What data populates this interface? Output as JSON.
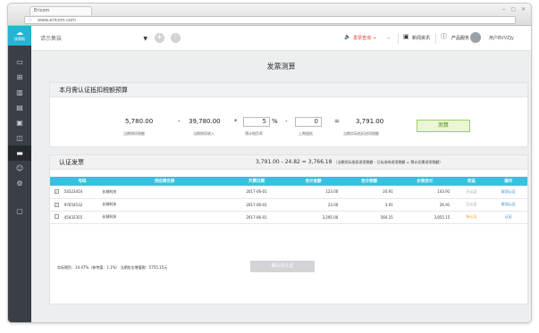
{
  "browser": {
    "tab_title": "Ericom",
    "url": "www.ericom.com",
    "win_controls": "‒ ▢ ✕"
  },
  "sidebar": {
    "logo_text": "核票助",
    "items": [
      {
        "icon": "square-icon"
      },
      {
        "icon": "plus-box-icon"
      },
      {
        "icon": "chart-icon"
      },
      {
        "icon": "document-icon"
      },
      {
        "icon": "clipboard-icon"
      },
      {
        "icon": "invoice-icon"
      },
      {
        "icon": "stamp-icon",
        "active": true
      },
      {
        "icon": "people-icon"
      },
      {
        "icon": "gear-icon"
      },
      {
        "icon": "window-icon"
      }
    ]
  },
  "topbar": {
    "company_placeholder": "请示集装",
    "alert_text": "发票查询 →",
    "news_label": "新闻资讯",
    "help_label": "产品服务",
    "username": "用户BVVZJy"
  },
  "page_title": "发票测算",
  "budget": {
    "heading": "本月需认证抵扣税额预算",
    "values": {
      "a": "5,780.00",
      "op1": "-",
      "b": "39,780.00",
      "op2": "*",
      "rate": "5",
      "rate_unit": "%",
      "op3": "-",
      "prev": "0",
      "op4": "=",
      "result": "3,791.00"
    },
    "captions": {
      "a": "当期销项税额",
      "b": "当期销项收入",
      "rate": "预计税负率",
      "prev": "上期留抵",
      "result": "当期实际抵扣进项税额"
    },
    "measure_button": "测算"
  },
  "invoices": {
    "heading": "认证发票",
    "formula": {
      "text": "3,791.00 - 24.82 = 3,766.18",
      "note": "（当期实际抵扣进项税额 - 已勾选待进项税额 = 预计还需进项税额）"
    },
    "columns": [
      "号码",
      "供应商名称",
      "开票日期",
      "合计金额",
      "合计税额",
      "价税合计",
      "状态",
      "操作"
    ],
    "rows": [
      {
        "checked": true,
        "number": "54323454",
        "supplier": "长城科技",
        "date": "2017-06-01",
        "amount": "123.00",
        "tax": "20.91",
        "total": "143.91",
        "status": "已认证",
        "status_type": "ok",
        "action": "取消认证"
      },
      {
        "checked": true,
        "number": "97654532",
        "supplier": "长城科技",
        "date": "2017-06-01",
        "amount": "23.00",
        "tax": "3.91",
        "total": "26.91",
        "status": "已认证",
        "status_type": "ok",
        "action": "取消认证"
      },
      {
        "checked": false,
        "number": "45432355",
        "supplier": "长城科技",
        "date": "2017-06-01",
        "amount": "3,295.00",
        "tax": "560.15",
        "total": "3,855.15",
        "status": "待认证",
        "status_type": "warn",
        "action": "认证"
      }
    ],
    "footer": "实际税负：14.47%（参考值：1.1%） 当期应交增值税：5755.15元",
    "confirm_button": "确认并认证"
  }
}
